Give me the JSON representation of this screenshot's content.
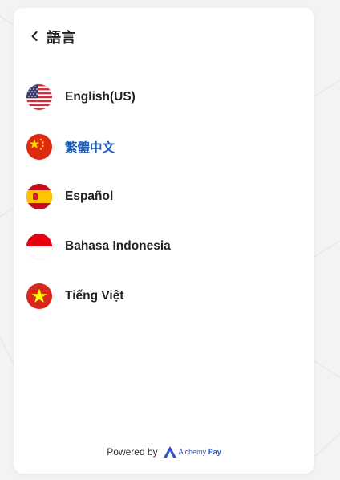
{
  "header": {
    "title": "語言",
    "back_icon": "chevron-left-icon"
  },
  "languages": [
    {
      "label": "English(US)",
      "flag": "us-flag-icon",
      "selected": false
    },
    {
      "label": "繁體中文",
      "flag": "china-flag-icon",
      "selected": true
    },
    {
      "label": "Español",
      "flag": "spain-flag-icon",
      "selected": false
    },
    {
      "label": "Bahasa Indonesia",
      "flag": "indonesia-flag-icon",
      "selected": false
    },
    {
      "label": "Tiếng Việt",
      "flag": "vietnam-flag-icon",
      "selected": false
    }
  ],
  "footer": {
    "powered_by": "Powered by",
    "brand_light": "Alchemy",
    "brand_bold": "Pay"
  },
  "colors": {
    "selected_text": "#1a5bb5",
    "brand": "#2a54c7"
  }
}
